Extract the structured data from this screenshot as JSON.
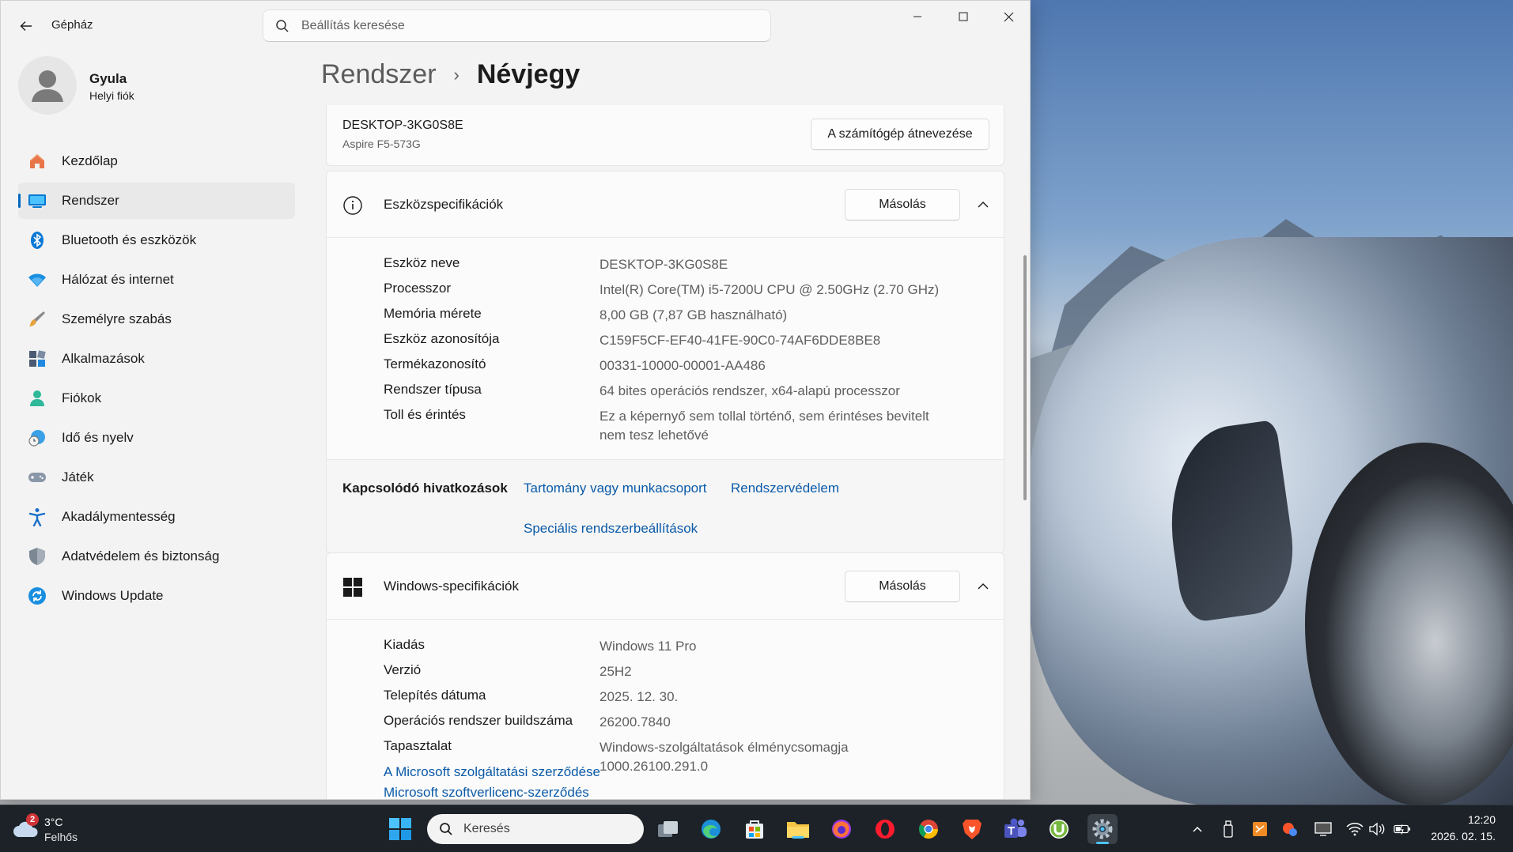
{
  "window": {
    "app_title": "Gépház",
    "search_placeholder": "Beállítás keresése"
  },
  "profile": {
    "name": "Gyula",
    "account_type": "Helyi fiók"
  },
  "sidebar": {
    "items": [
      {
        "label": "Kezdőlap",
        "icon": "home-icon"
      },
      {
        "label": "Rendszer",
        "icon": "system-icon",
        "active": true
      },
      {
        "label": "Bluetooth és eszközök",
        "icon": "bluetooth-icon"
      },
      {
        "label": "Hálózat és internet",
        "icon": "wifi-icon"
      },
      {
        "label": "Személyre szabás",
        "icon": "brush-icon"
      },
      {
        "label": "Alkalmazások",
        "icon": "apps-icon"
      },
      {
        "label": "Fiókok",
        "icon": "account-icon"
      },
      {
        "label": "Idő és nyelv",
        "icon": "globe-clock-icon"
      },
      {
        "label": "Játék",
        "icon": "gamepad-icon"
      },
      {
        "label": "Akadálymentesség",
        "icon": "accessibility-icon"
      },
      {
        "label": "Adatvédelem és biztonság",
        "icon": "shield-icon"
      },
      {
        "label": "Windows Update",
        "icon": "update-icon"
      }
    ]
  },
  "breadcrumb": {
    "parent": "Rendszer",
    "separator": "›",
    "current": "Névjegy"
  },
  "device": {
    "name": "DESKTOP-3KG0S8E",
    "model": "Aspire F5-573G",
    "rename_label": "A számítógép átnevezése"
  },
  "device_specs": {
    "title": "Eszközspecifikációk",
    "copy_label": "Másolás",
    "rows": [
      {
        "key": "Eszköz neve",
        "value": "DESKTOP-3KG0S8E"
      },
      {
        "key": "Processzor",
        "value": "Intel(R) Core(TM) i5-7200U CPU @ 2.50GHz (2.70 GHz)"
      },
      {
        "key": "Memória mérete",
        "value": "8,00 GB (7,87 GB használható)"
      },
      {
        "key": "Eszköz azonosítója",
        "value": "C159F5CF-EF40-41FE-90C0-74AF6DDE8BE8"
      },
      {
        "key": "Termékazonosító",
        "value": "00331-10000-00001-AA486"
      },
      {
        "key": "Rendszer típusa",
        "value": "64 bites operációs rendszer, x64-alapú processzor"
      },
      {
        "key": "Toll és érintés",
        "value": "Ez a képernyő sem tollal történő, sem érintéses bevitelt nem tesz lehetővé"
      }
    ]
  },
  "related": {
    "title": "Kapcsolódó hivatkozások",
    "links": [
      "Tartomány vagy munkacsoport",
      "Rendszervédelem",
      "Speciális rendszerbeállítások"
    ]
  },
  "windows_specs": {
    "title": "Windows-specifikációk",
    "copy_label": "Másolás",
    "rows": [
      {
        "key": "Kiadás",
        "value": "Windows 11 Pro"
      },
      {
        "key": "Verzió",
        "value": "25H2"
      },
      {
        "key": "Telepítés dátuma",
        "value": "2025. 12. 30."
      },
      {
        "key": "Operációs rendszer buildszáma",
        "value": "26200.7840"
      },
      {
        "key": "Tapasztalat",
        "value": "Windows-szolgáltatások élménycsomagja 1000.26100.291.0"
      }
    ],
    "links": [
      "A Microsoft szolgáltatási szerződése",
      "Microsoft szoftverlicenc-szerződés"
    ]
  },
  "taskbar": {
    "weather_badge": "2",
    "temperature": "3°C",
    "condition": "Felhős",
    "search_text": "Keresés",
    "time": "12:20",
    "date": "2026. 02. 15."
  },
  "colors": {
    "accent": "#0067c0",
    "link": "#0a5aa8",
    "window_bg": "#f3f3f3",
    "card_bg": "#fbfbfb",
    "taskbar_bg": "#1c2228"
  }
}
